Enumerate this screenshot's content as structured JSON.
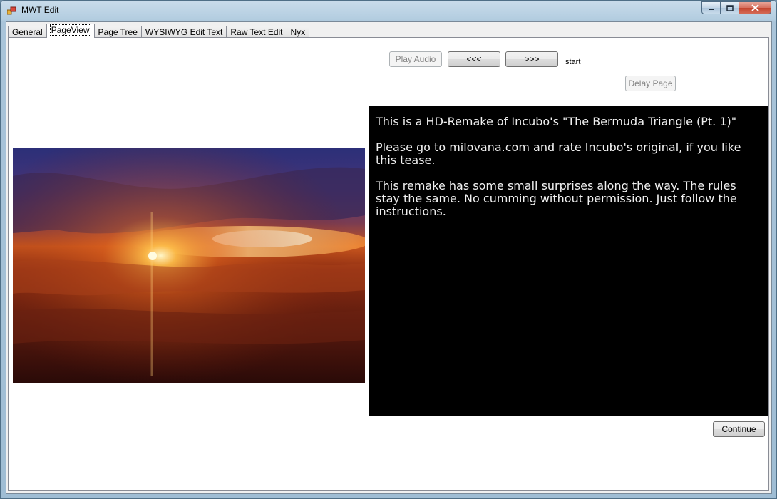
{
  "window": {
    "title": "MWT Edit",
    "caption_buttons": {
      "minimize_icon": "minimize-icon",
      "maximize_icon": "maximize-icon",
      "close_icon": "close-icon"
    }
  },
  "tabs": [
    {
      "label": "General",
      "active": false
    },
    {
      "label": "PageView",
      "active": true
    },
    {
      "label": "Page Tree",
      "active": false
    },
    {
      "label": "WYSIWYG Edit Text",
      "active": false
    },
    {
      "label": "Raw Text Edit",
      "active": false
    },
    {
      "label": "Nyx",
      "active": false
    }
  ],
  "pageview": {
    "play_audio_label": "Play Audio",
    "prev_label": "<<<",
    "next_label": ">>>",
    "page_name": "start",
    "delay_page_label": "Delay Page",
    "continue_label": "Continue",
    "picture_icon": "sunset-over-clouds-image",
    "text_paragraphs": [
      "This is a HD-Remake of Incubo's \"The Bermuda Triangle (Pt. 1)\"",
      "Please go to milovana.com and rate Incubo's original, if you like this tease.",
      "This remake has some small surprises along the way. The rules stay the same. No cumming without permission. Just follow the instructions."
    ]
  },
  "colors": {
    "text_panel_bg": "#000000",
    "text_panel_fg": "#f0f0f0",
    "close_button": "#c4452f"
  }
}
